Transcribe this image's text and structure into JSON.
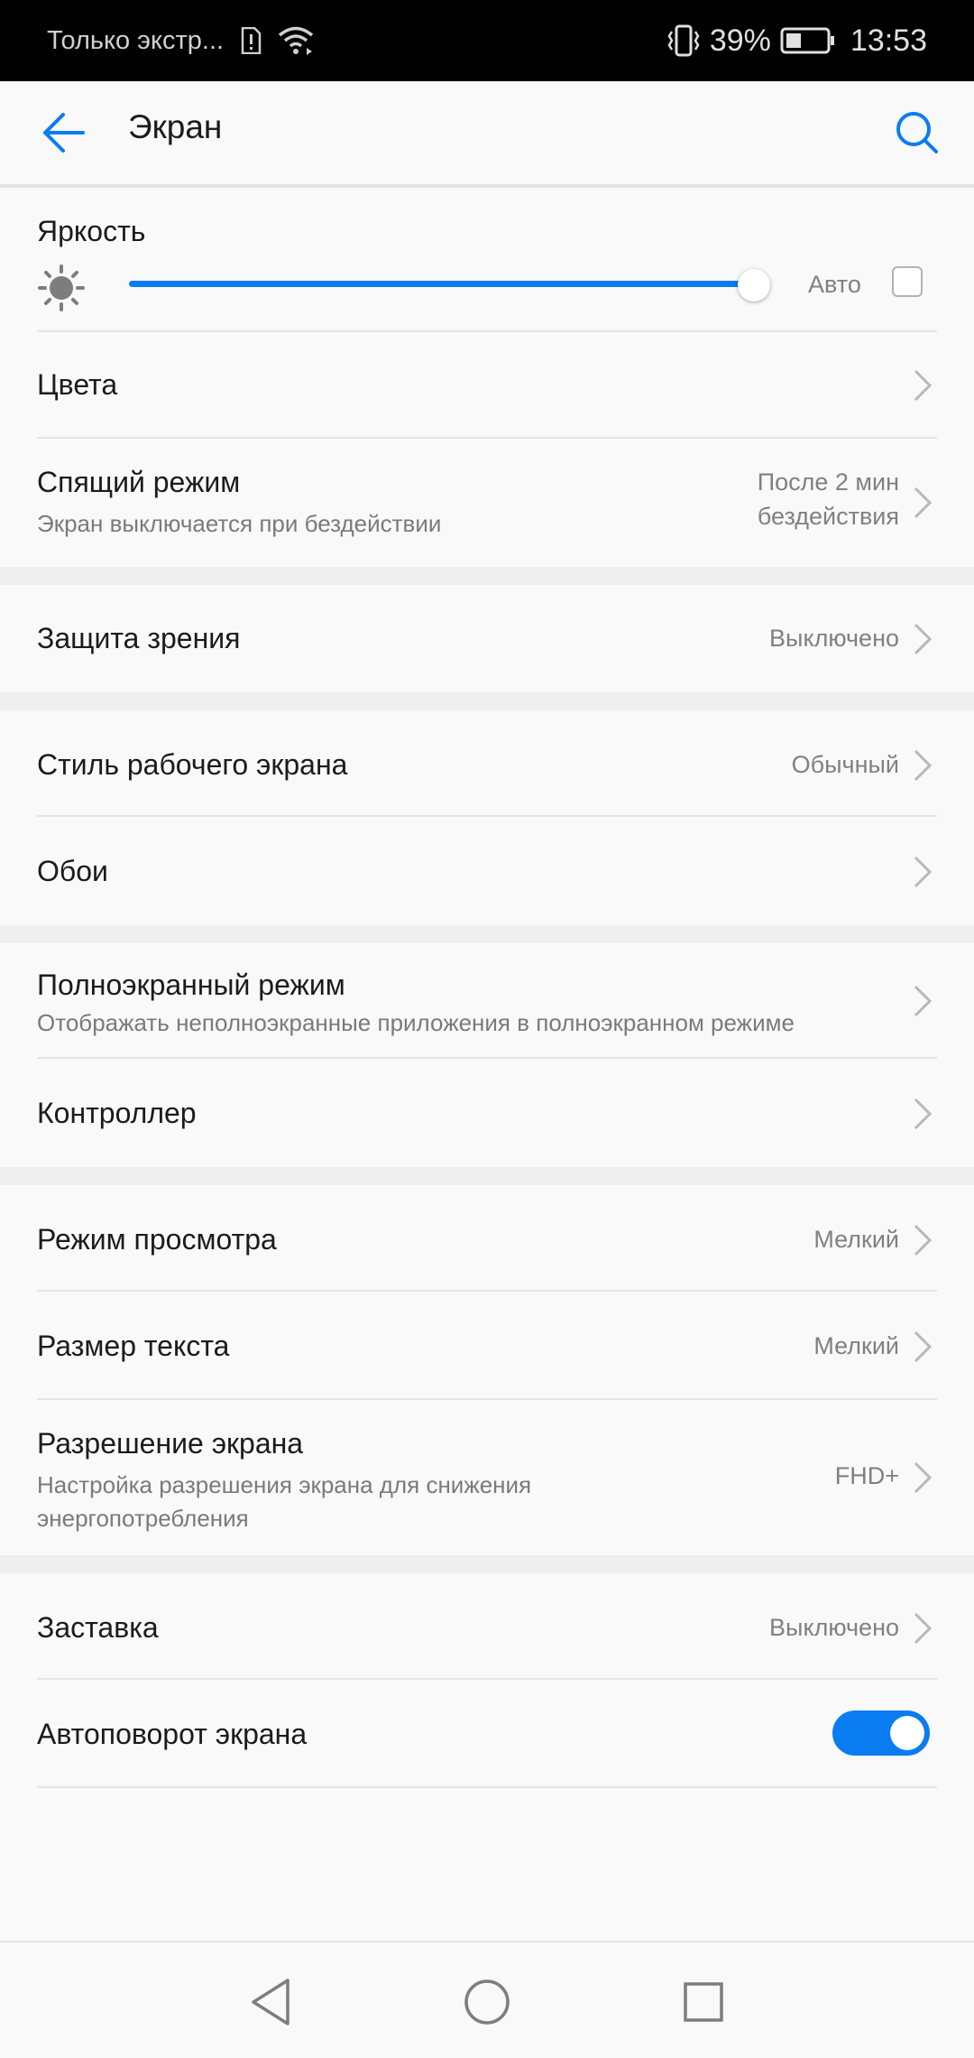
{
  "status_bar": {
    "carrier_text": "Только экстр...",
    "battery_percent": "39%",
    "battery_level": 0.39,
    "time": "13:53",
    "icons": [
      "alert-sim-icon",
      "wifi-icon",
      "vibrate-icon",
      "battery-icon"
    ]
  },
  "app_bar": {
    "title": "Экран",
    "back_icon": "arrow-left-icon",
    "search_icon": "search-icon"
  },
  "colors": {
    "accent": "#0a7cf1",
    "text_primary": "#1b1b1b",
    "text_secondary": "#7a7a7a"
  },
  "brightness": {
    "title": "Яркость",
    "level": 0.99,
    "auto_label": "Авто",
    "auto_checked": false
  },
  "rows": {
    "colors": {
      "title": "Цвета"
    },
    "sleep": {
      "title": "Спящий режим",
      "subtitle": "Экран выключается при бездействии",
      "value_line1": "После 2 мин",
      "value_line2": "бездействия"
    },
    "eye_comfort": {
      "title": "Защита зрения",
      "value": "Выключено"
    },
    "home_style": {
      "title": "Стиль рабочего экрана",
      "value": "Обычный"
    },
    "wallpaper": {
      "title": "Обои"
    },
    "fullscreen": {
      "title": "Полноэкранный режим",
      "subtitle": "Отображать неполноэкранные приложения в полноэкранном режиме"
    },
    "controller": {
      "title": "Контроллер"
    },
    "view_mode": {
      "title": "Режим просмотра",
      "value": "Мелкий"
    },
    "text_size": {
      "title": "Размер текста",
      "value": "Мелкий"
    },
    "resolution": {
      "title": "Разрешение экрана",
      "subtitle_line1": "Настройка разрешения экрана для снижения",
      "subtitle_line2": "энергопотребления",
      "value": "FHD+"
    },
    "screensaver": {
      "title": "Заставка",
      "value": "Выключено"
    },
    "autorotate": {
      "title": "Автоповорот экрана",
      "enabled": true
    }
  },
  "nav_bar": {
    "back": "triangle-back-icon",
    "home": "circle-home-icon",
    "recents": "square-recents-icon"
  }
}
